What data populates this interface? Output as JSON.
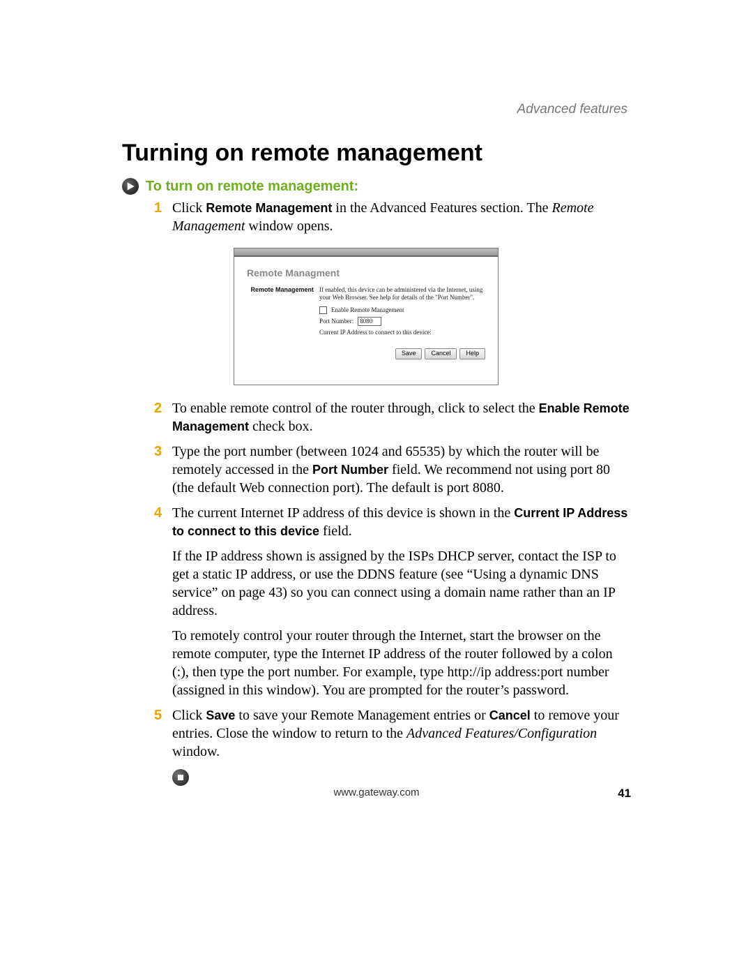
{
  "running_head": "Advanced features",
  "section_title": "Turning on remote management",
  "howto_heading": "To turn on remote management:",
  "steps": {
    "s1_a": "Click ",
    "s1_b_bold": "Remote Management",
    "s1_c": " in the Advanced Features section. The ",
    "s1_d_ital": "Remote Management",
    "s1_e": " window opens.",
    "s2_a": "To enable remote control of the router through, click to select the ",
    "s2_b_bold": "Enable Remote Management",
    "s2_c": " check box.",
    "s3_a": "Type the port number (between 1024 and 65535) by which the router will be remotely accessed in the ",
    "s3_b_bold": "Port Number",
    "s3_c": " field. We recommend not using port 80 (the default Web connection port). The default is port 8080.",
    "s4_a": "The current Internet IP address of this device is shown in the ",
    "s4_b_bold": "Current IP Address to connect to this device",
    "s4_c": " field.",
    "s5_a": "Click ",
    "s5_b_bold": "Save",
    "s5_c": " to save your Remote Management entries or ",
    "s5_d_bold": "Cancel",
    "s5_e": " to remove your entries. Close the window to return to the ",
    "s5_f_ital": "Advanced Features/Configuration",
    "s5_g": " window."
  },
  "para1": "If the IP address shown is assigned by the ISPs DHCP server, contact the ISP to get a static IP address, or use the DDNS feature (see “Using a dynamic DNS service” on page 43) so you can connect using a domain name rather than an IP address.",
  "para2": "To remotely control your router through the Internet, start the browser on the remote computer, type the Internet IP address of the router followed by a colon (:), then type the port number. For example, type http://ip address:port number (assigned in this window). You are prompted for the router’s password.",
  "screenshot": {
    "panel_title": "Remote Managment",
    "row_label": "Remote Management",
    "desc": "If enabled, this device can be administered via the Internet, using your Web Browser. See help for details of the \"Port Number\".",
    "enable_label": "Enable Remote Management",
    "port_label": "Port Number:",
    "port_value": "8080",
    "current_ip_label": "Current IP Address to connect to this device:",
    "btn_save": "Save",
    "btn_cancel": "Cancel",
    "btn_help": "Help"
  },
  "footer_url": "www.gateway.com",
  "page_number": "41"
}
